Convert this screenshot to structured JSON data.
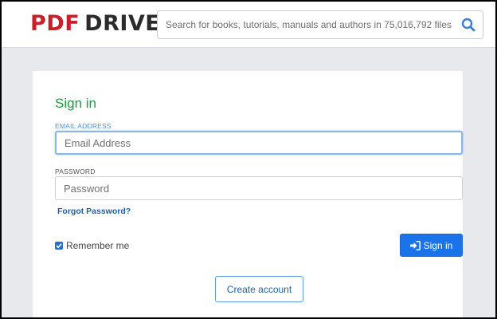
{
  "header": {
    "logo_pdf": "PDF",
    "logo_drive": "DRIVE",
    "search_placeholder": "Search for books, tutorials, manuals and authors in 75,016,792 files",
    "search_icon": "search-icon"
  },
  "form": {
    "title": "Sign in",
    "email_label": "EMAIL ADDRESS",
    "email_placeholder": "Email Address",
    "email_value": "",
    "password_label": "PASSWORD",
    "password_placeholder": "Password",
    "password_value": "",
    "forgot_link": "Forgot Password?",
    "remember_label": "Remember me",
    "remember_checked": true,
    "signin_button": "Sign in",
    "signin_icon": "sign-in-icon",
    "create_account_button": "Create account"
  },
  "colors": {
    "brand_red": "#c8202b",
    "title_green": "#1c9b3a",
    "primary_blue": "#1a73e8"
  }
}
